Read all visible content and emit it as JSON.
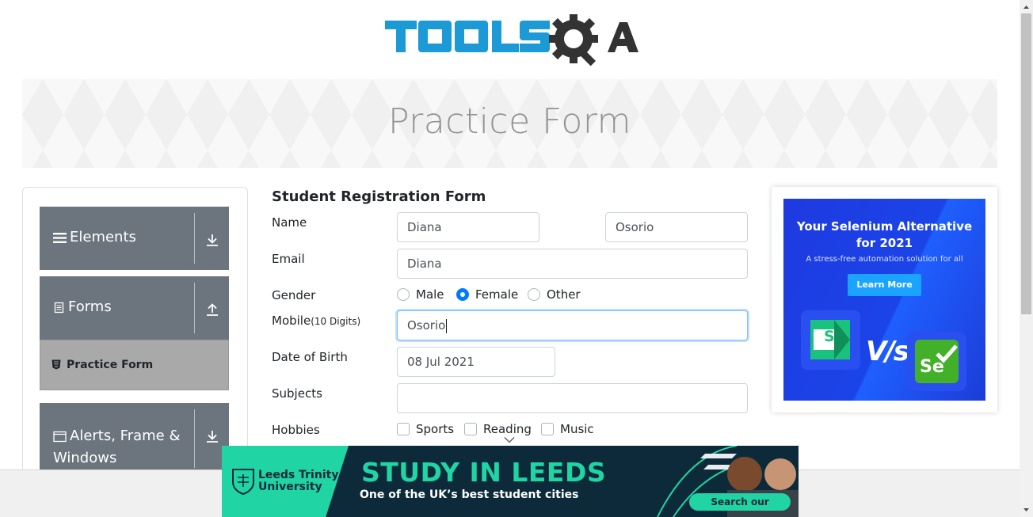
{
  "header": {
    "logo_text": "TOOLSQA"
  },
  "banner": {
    "title": "Practice Form"
  },
  "sidebar": {
    "groups": [
      {
        "label": "Elements",
        "icon": "hamburger-icon",
        "arrow": "download-icon"
      },
      {
        "label": "Forms",
        "icon": "document-icon",
        "arrow": "upload-icon"
      },
      {
        "label": "Alerts, Frame &",
        "label2": "Windows",
        "icon": "window-icon",
        "arrow": "download-icon"
      }
    ],
    "active_item": {
      "label": "Practice Form",
      "icon": "html5-icon"
    }
  },
  "form": {
    "title": "Student Registration Form",
    "name_label": "Name",
    "first_name": "Diana",
    "last_name": "Osorio",
    "email_label": "Email",
    "email": "Diana",
    "gender_label": "Gender",
    "gender_options": [
      "Male",
      "Female",
      "Other"
    ],
    "gender_selected": "Female",
    "mobile_label": "Mobile",
    "mobile_hint": "(10 Digits)",
    "mobile": "Osorio",
    "dob_label": "Date of Birth",
    "dob": "08 Jul 2021",
    "subjects_label": "Subjects",
    "subjects": "",
    "hobbies_label": "Hobbies",
    "hobbies": [
      "Sports",
      "Reading",
      "Music"
    ]
  },
  "side_ad": {
    "headline_1": "Your Selenium Alternative",
    "headline_2": "for 2021",
    "subline": "A stress-free automation solution for all",
    "button": "Learn More",
    "vs": "V/s",
    "left_logo": "S",
    "right_logo": "Se"
  },
  "bottom_ad": {
    "brand_1": "Leeds Trinity",
    "brand_2": "University",
    "headline": "STUDY IN LEEDS",
    "subline": "One of the UK’s best student cities",
    "cta": "Search our courses›"
  },
  "colors": {
    "logo_blue": "#1b9ad6",
    "logo_dark": "#333333",
    "sidebar_header": "#6c757d",
    "active_item": "#a9a9a9",
    "radio_checked": "#007bff",
    "ad_blue": "#1e3ae0",
    "leeds_green": "#20d4a4",
    "leeds_dark": "#0c2a3a"
  }
}
